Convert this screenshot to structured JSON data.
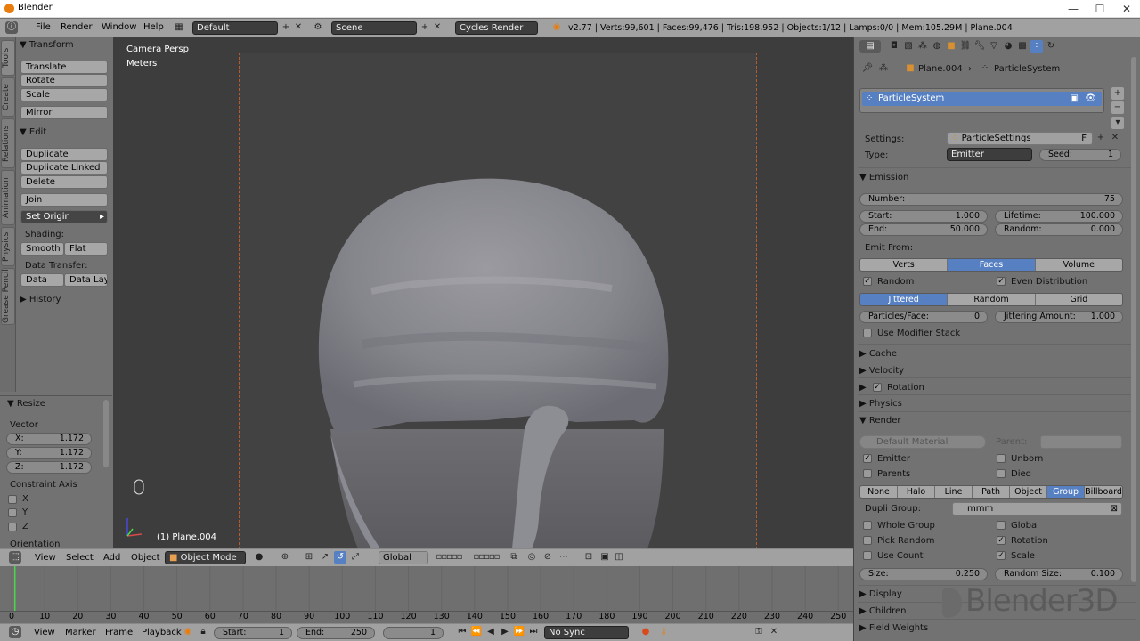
{
  "window": {
    "title": "Blender",
    "min": "—",
    "max": "☐",
    "close": "✕"
  },
  "menubar": {
    "items": [
      "File",
      "Render",
      "Window",
      "Help"
    ],
    "layout": "Default",
    "scene": "Scene",
    "engine": "Cycles Render",
    "stats": "v2.77 | Verts:99,601 | Faces:99,476 | Tris:198,952 | Objects:1/12 | Lamps:0/0 | Mem:105.29M | Plane.004"
  },
  "tool_tabs": [
    "Tools",
    "Create",
    "Relations",
    "Animation",
    "Physics",
    "Grease Pencil"
  ],
  "tools": {
    "transform_header": "Transform",
    "translate": "Translate",
    "rotate": "Rotate",
    "scale": "Scale",
    "mirror": "Mirror",
    "edit_header": "Edit",
    "duplicate": "Duplicate",
    "duplicate_linked": "Duplicate Linked",
    "delete": "Delete",
    "join": "Join",
    "set_origin": "Set Origin",
    "shading_label": "Shading:",
    "smooth": "Smooth",
    "flat": "Flat",
    "data_transfer_label": "Data Transfer:",
    "data": "Data",
    "data_layo": "Data Layo",
    "history_header": "History"
  },
  "redo": {
    "header": "Resize",
    "vector_label": "Vector",
    "x_label": "X:",
    "x": "1.172",
    "y_label": "Y:",
    "y": "1.172",
    "z_label": "Z:",
    "z": "1.172",
    "constraint_label": "Constraint Axis",
    "cx": "X",
    "cy": "Y",
    "cz": "Z",
    "orientation_label": "Orientation"
  },
  "viewport": {
    "camera": "Camera Persp",
    "units": "Meters",
    "object": "(1) Plane.004"
  },
  "vp_header": {
    "view": "View",
    "select": "Select",
    "add": "Add",
    "object": "Object",
    "mode": "Object Mode",
    "orientation": "Global"
  },
  "timeline": {
    "ticks": [
      "0",
      "10",
      "20",
      "30",
      "40",
      "50",
      "60",
      "70",
      "80",
      "90",
      "100",
      "110",
      "120",
      "130",
      "140",
      "150",
      "160",
      "170",
      "180",
      "190",
      "200",
      "210",
      "220",
      "230",
      "240",
      "250"
    ],
    "view": "View",
    "marker": "Marker",
    "frame": "Frame",
    "playback": "Playback",
    "start_label": "Start:",
    "start": "1",
    "end_label": "End:",
    "end": "250",
    "current": "1",
    "sync": "No Sync"
  },
  "props": {
    "breadcrumb_obj": "Plane.004",
    "breadcrumb_ps": "ParticleSystem",
    "ps_list_item": "ParticleSystem",
    "settings_label": "Settings:",
    "settings": "ParticleSettings",
    "settings_f": "F",
    "type_label": "Type:",
    "type": "Emitter",
    "seed_label": "Seed:",
    "seed": "1",
    "emission_header": "Emission",
    "number_label": "Number:",
    "number": "75",
    "start_label": "Start:",
    "start": "1.000",
    "lifetime_label": "Lifetime:",
    "lifetime": "100.000",
    "end_label": "End:",
    "end": "50.000",
    "random_label": "Random:",
    "random": "0.000",
    "emit_from_label": "Emit From:",
    "emit_from": [
      "Verts",
      "Faces",
      "Volume"
    ],
    "emit_random": "Random",
    "even_distribution": "Even Distribution",
    "distribution": [
      "Jittered",
      "Random",
      "Grid"
    ],
    "particles_face_label": "Particles/Face:",
    "particles_face": "0",
    "jitter_label": "Jittering Amount:",
    "jitter": "1.000",
    "use_modifier_stack": "Use Modifier Stack",
    "cache": "Cache",
    "velocity": "Velocity",
    "rotation": "Rotation",
    "physics": "Physics",
    "render_header": "Render",
    "material": "Default Material",
    "parent_label": "Parent:",
    "emitter": "Emitter",
    "unborn": "Unborn",
    "parents": "Parents",
    "died": "Died",
    "render_as": [
      "None",
      "Halo",
      "Line",
      "Path",
      "Object",
      "Group",
      "Billboard"
    ],
    "dupli_group_label": "Dupli Group:",
    "dupli_group": "mmm",
    "whole_group": "Whole Group",
    "global": "Global",
    "pick_random": "Pick Random",
    "rot": "Rotation",
    "use_count": "Use Count",
    "scale": "Scale",
    "size_label": "Size:",
    "size": "0.250",
    "random_size_label": "Random Size:",
    "random_size": "0.100",
    "display": "Display",
    "children": "Children",
    "field_weights": "Field Weights"
  },
  "watermark": "Blender3D"
}
